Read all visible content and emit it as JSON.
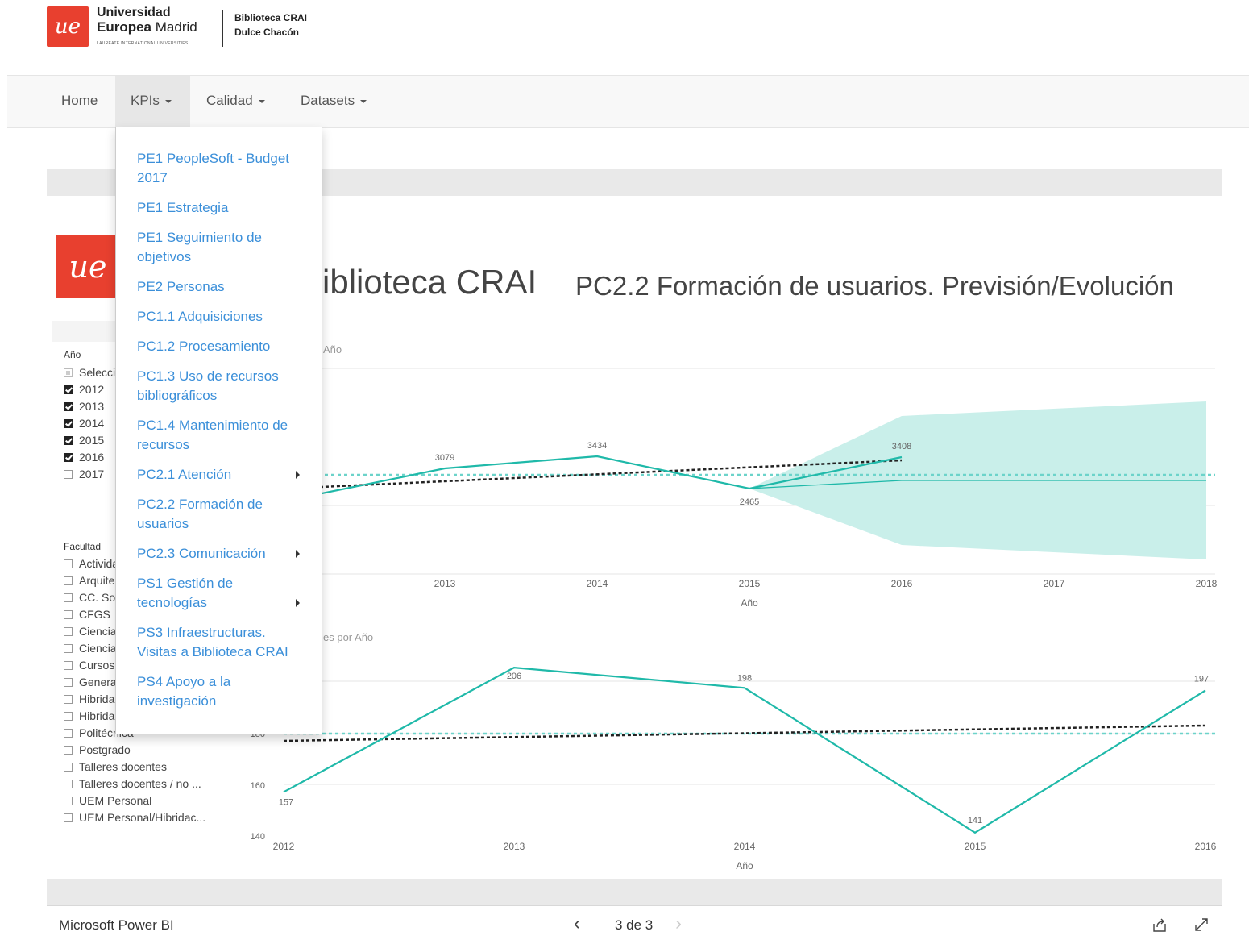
{
  "header": {
    "logo_text": "ue",
    "university_line1": "Universidad",
    "university_line2_bold": "Europea",
    "university_line2_rest": " Madrid",
    "university_tagline": "LAUREATE INTERNATIONAL UNIVERSITIES",
    "library_line1": "Biblioteca CRAI",
    "library_line2": "Dulce Chacón"
  },
  "navbar": {
    "items": [
      {
        "label": "Home"
      },
      {
        "label": "KPIs"
      },
      {
        "label": "Calidad"
      },
      {
        "label": "Datasets"
      }
    ]
  },
  "dropdown": {
    "items": [
      {
        "label": "PE1 PeopleSoft - Budget 2017"
      },
      {
        "label": "PE1 Estrategia"
      },
      {
        "label": "PE1 Seguimiento de objetivos"
      },
      {
        "label": "PE2 Personas"
      },
      {
        "label": "PC1.1 Adquisiciones"
      },
      {
        "label": "PC1.2 Procesamiento"
      },
      {
        "label": "PC1.3 Uso de recursos bibliográficos"
      },
      {
        "label": "PC1.4 Mantenimiento de recursos"
      },
      {
        "label": "PC2.1 Atención",
        "submenu": true
      },
      {
        "label": "PC2.2 Formación de usuarios"
      },
      {
        "label": "PC2.3 Comunicación",
        "submenu": true
      },
      {
        "label": "PS1 Gestión de tecnologías",
        "submenu": true
      },
      {
        "label": "PS3 Infraestructuras. Visitas a Biblioteca CRAI"
      },
      {
        "label": "PS4 Apoyo a la investigación"
      }
    ]
  },
  "report": {
    "logo_text": "ue",
    "title": "Biblioteca CRAI",
    "subtitle": "PC2.2 Formación de usuarios. Previsión/Evolución"
  },
  "slicers": {
    "year": {
      "title": "Año",
      "items": [
        {
          "label": "Seleccionar todo",
          "state": "partial"
        },
        {
          "label": "2012",
          "state": "on"
        },
        {
          "label": "2013",
          "state": "on"
        },
        {
          "label": "2014",
          "state": "on"
        },
        {
          "label": "2015",
          "state": "on"
        },
        {
          "label": "2016",
          "state": "on"
        },
        {
          "label": "2017",
          "state": "off"
        }
      ]
    },
    "faculty": {
      "title": "Facultad",
      "items": [
        {
          "label": "Actividades"
        },
        {
          "label": "Arquitectura"
        },
        {
          "label": "CC. Sociales"
        },
        {
          "label": "CFGS"
        },
        {
          "label": "Ciencias"
        },
        {
          "label": "Ciencias"
        },
        {
          "label": "Cursos"
        },
        {
          "label": "General"
        },
        {
          "label": "Hibridación"
        },
        {
          "label": "Hibridación"
        },
        {
          "label": "Politécnica"
        },
        {
          "label": "Postgrado"
        },
        {
          "label": "Talleres docentes"
        },
        {
          "label": "Talleres docentes / no ..."
        },
        {
          "label": "UEM Personal"
        },
        {
          "label": "UEM Personal/Hibridac..."
        }
      ]
    }
  },
  "chart_data": [
    {
      "type": "line",
      "title": "Año",
      "xlabel": "Año",
      "x": [
        2012,
        2013,
        2014,
        2015,
        2016
      ],
      "x_ticks": [
        "2013",
        "2014",
        "2015",
        "2016",
        "2017",
        "2018"
      ],
      "series": [
        {
          "values": [
            null,
            3079,
            3434,
            2465,
            3408
          ]
        }
      ],
      "data_labels": [
        "3079",
        "3434",
        "2465",
        "3408"
      ],
      "forecast": {
        "x": [
          2015,
          2016,
          2017,
          2018
        ],
        "has_confidence_band": true
      },
      "trend_line": true,
      "average_line": true,
      "colors": {
        "series": "#1fb9a9",
        "band": "#c9efea",
        "trend": "#222222",
        "average": "#6cd3ca"
      }
    },
    {
      "type": "line",
      "title": "es por Año",
      "xlabel": "Año",
      "x": [
        2012,
        2013,
        2014,
        2015,
        2016
      ],
      "series": [
        {
          "values": [
            157,
            206,
            198,
            141,
            197
          ]
        }
      ],
      "data_labels": [
        "157",
        "206",
        "198",
        "141",
        "197"
      ],
      "y_ticks": [
        "140",
        "160",
        "180"
      ],
      "x_ticks": [
        "2012",
        "2013",
        "2014",
        "2015",
        "2016"
      ],
      "trend_line": true,
      "average_line": true,
      "colors": {
        "series": "#1fb9a9",
        "trend": "#222222",
        "average": "#6cd3ca"
      }
    }
  ],
  "footer": {
    "app_name": "Microsoft Power BI",
    "prev": "‹",
    "page": "3 de 3",
    "next": "›"
  }
}
